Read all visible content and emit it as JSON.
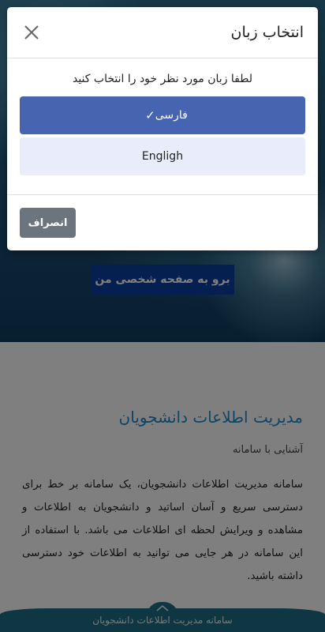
{
  "hero": {
    "button_label": "برو به صفحه شخصی من"
  },
  "content": {
    "title": "مدیریت اطلاعات دانشجویان",
    "subtitle": "آشنایی با سامانه",
    "body": "سامانه مدیریت اطلاعات دانشجویان، یک سامانه بر خط برای دسترسی سریع و آسان اساتید و دانشجویان به اطلاعات و مشاهده و ویرایش لحظه ای اطلاعات می باشد. با استفاده از این سامانه در هر جایی می توانید به اطلاعات خود دسترسی داشته باشید."
  },
  "footer": {
    "text": "سامانه مدیریت اطلاعات دانشجویان",
    "up_icon": "chevron-up-icon"
  },
  "modal": {
    "title": "انتخاب زبان",
    "close_icon": "close-icon",
    "prompt": "لطفا زبان مورد نظر خود را انتخاب کنید",
    "options": [
      {
        "label": "فارسی",
        "selected": true,
        "check": "✓"
      },
      {
        "label": "Engligh",
        "selected": false
      }
    ],
    "cancel_label": "انصراف"
  },
  "colors": {
    "selected_option": "#4664b0",
    "unselected_option": "#e9ecfb",
    "cancel_button": "#6c757d",
    "title_accent": "#1e88c8",
    "hero_button": "#0b3fa0",
    "footer": "#1c6f86"
  }
}
